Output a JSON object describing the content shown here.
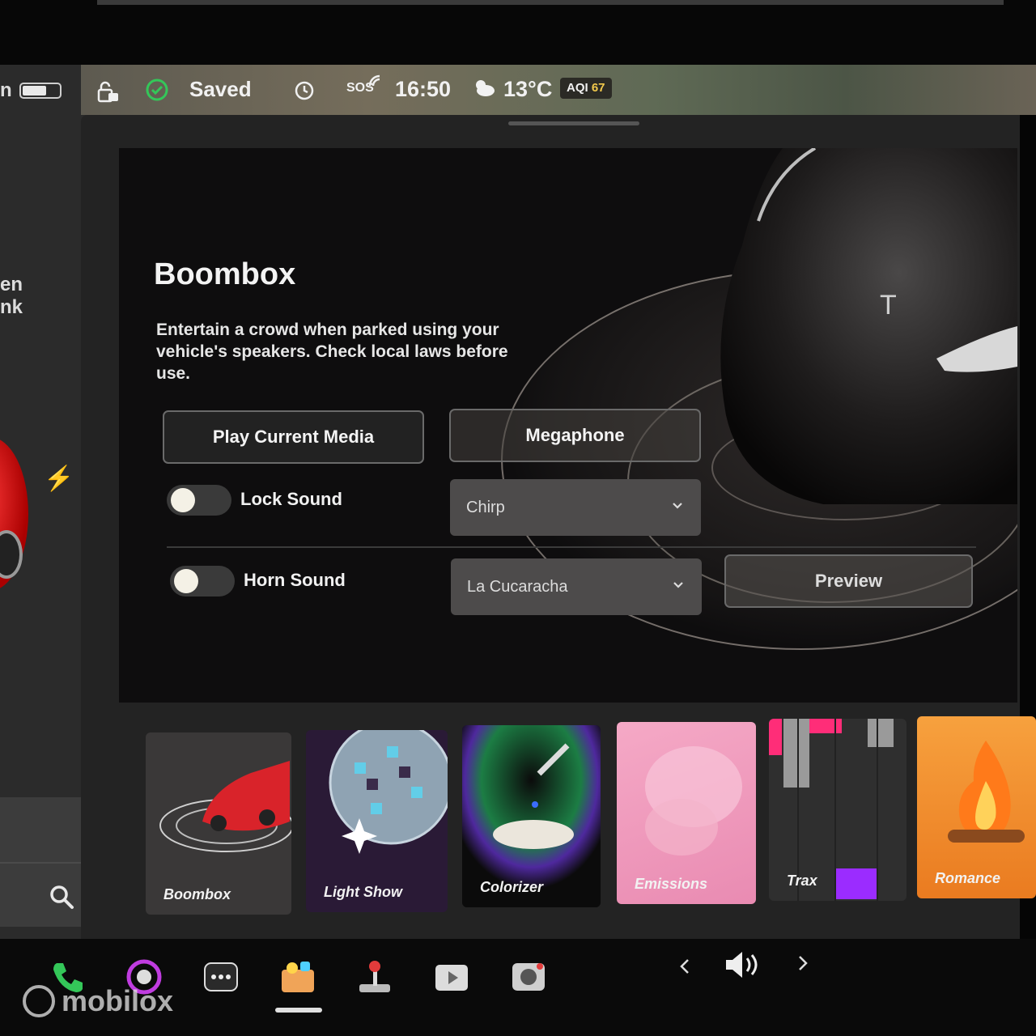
{
  "left_panel": {
    "battery_text": "n",
    "cut_open_lines": [
      "en",
      "nk"
    ],
    "bolt_glyph": "⚡"
  },
  "status_bar": {
    "saved": "Saved",
    "sos": "SOS",
    "time": "16:50",
    "temperature": "13°C",
    "aqi_label": "AQI",
    "aqi_value": "67",
    "icons": [
      "lock-icon",
      "sentry-icon",
      "alarm-icon",
      "sos-icon",
      "weather-icon"
    ]
  },
  "boombox": {
    "title": "Boombox",
    "description": "Entertain a crowd when parked using your vehicle's speakers. Check local laws before use.",
    "play_button": "Play Current Media",
    "megaphone_button": "Megaphone",
    "lock_sound_label": "Lock Sound",
    "lock_sound_value": "Chirp",
    "horn_sound_label": "Horn Sound",
    "horn_sound_value": "La Cucaracha",
    "preview_button": "Preview"
  },
  "toys": [
    {
      "label": "Boombox"
    },
    {
      "label": "Light Show"
    },
    {
      "label": "Colorizer"
    },
    {
      "label": "Emissions"
    },
    {
      "label": "Trax"
    },
    {
      "label": "Romance"
    }
  ],
  "dock": {
    "icons": [
      "phone-icon",
      "camera-app-icon",
      "more-icon",
      "toybox-icon",
      "arcade-icon",
      "theater-icon",
      "dashcam-icon",
      "volume-icon"
    ]
  },
  "watermark": "mobilox",
  "colors": {
    "accent_green": "#34c759",
    "aqi_yellow": "#f2c94c",
    "trax_purple": "#9b2cff",
    "trax_pink": "#ff2d78"
  }
}
